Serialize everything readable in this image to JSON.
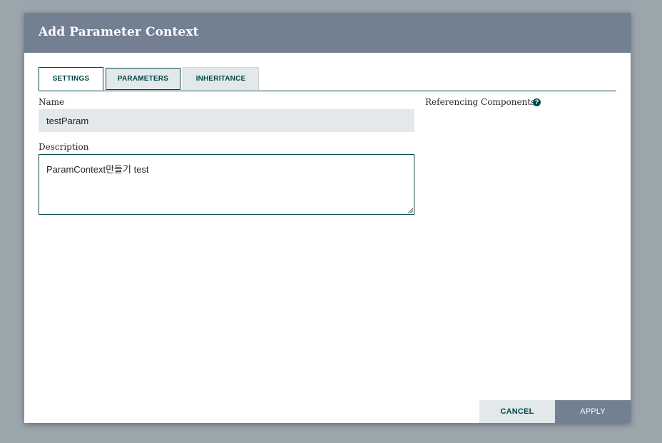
{
  "dialog": {
    "title": "Add Parameter Context"
  },
  "tabs": [
    {
      "label": "SETTINGS",
      "active": true
    },
    {
      "label": "PARAMETERS",
      "active": false
    },
    {
      "label": "INHERITANCE",
      "active": false
    }
  ],
  "settings": {
    "name_label": "Name",
    "name_value": "testParam",
    "description_label": "Description",
    "description_value": "ParamContext만들기 test",
    "referencing_label": "Referencing Components",
    "help_icon": "question-circle-icon"
  },
  "buttons": {
    "cancel": "CANCEL",
    "apply": "APPLY"
  },
  "colors": {
    "header": "#728092",
    "accent": "#004849",
    "input_bg": "#e3e8eb",
    "overlay": "#9ba5ac"
  }
}
